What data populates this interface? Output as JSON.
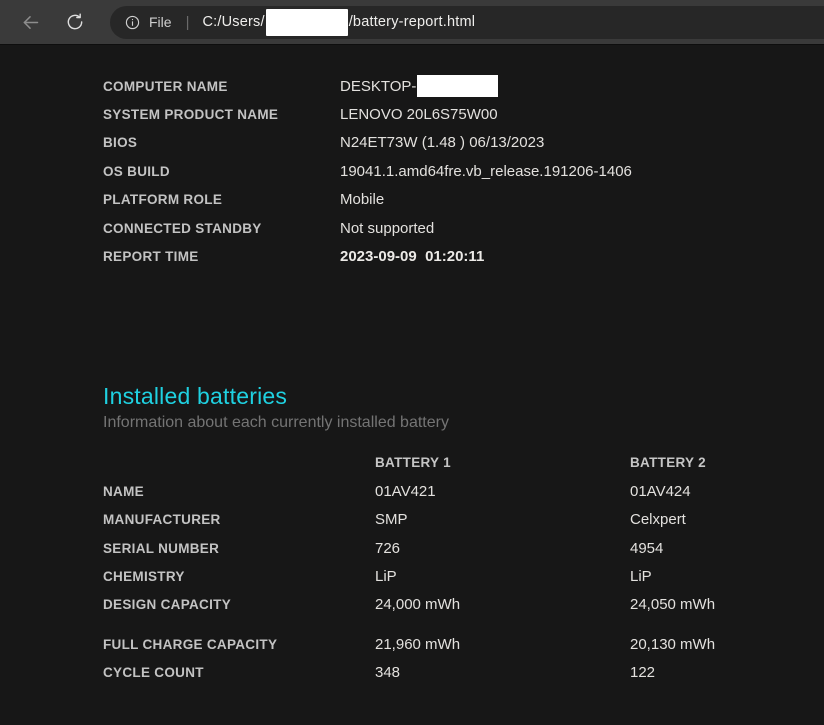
{
  "browser": {
    "address_bar": {
      "file_label": "File",
      "separator": "|",
      "url_prefix": "C:/Users/",
      "url_suffix": "/battery-report.html"
    }
  },
  "system_info": {
    "rows": [
      {
        "label": "COMPUTER NAME",
        "value": "DESKTOP-"
      },
      {
        "label": "SYSTEM PRODUCT NAME",
        "value": "LENOVO 20L6S75W00"
      },
      {
        "label": "BIOS",
        "value": "N24ET73W (1.48 ) 06/13/2023"
      },
      {
        "label": "OS BUILD",
        "value": "19041.1.amd64fre.vb_release.191206-1406"
      },
      {
        "label": "PLATFORM ROLE",
        "value": "Mobile"
      },
      {
        "label": "CONNECTED STANDBY",
        "value": "Not supported"
      },
      {
        "label": "REPORT TIME",
        "value": "2023-09-09  01:20:11"
      }
    ]
  },
  "installed_batteries": {
    "title": "Installed batteries",
    "subtitle": "Information about each currently installed battery",
    "columns": {
      "battery1": "BATTERY 1",
      "battery2": "BATTERY 2"
    },
    "rows": [
      {
        "label": "NAME",
        "battery1": "01AV421",
        "battery2": "01AV424"
      },
      {
        "label": "MANUFACTURER",
        "battery1": "SMP",
        "battery2": "Celxpert"
      },
      {
        "label": "SERIAL NUMBER",
        "battery1": "726",
        "battery2": "4954"
      },
      {
        "label": "CHEMISTRY",
        "battery1": "LiP",
        "battery2": "LiP"
      },
      {
        "label": "DESIGN CAPACITY",
        "battery1": "24,000 mWh",
        "battery2": "24,050 mWh"
      },
      {
        "label": "FULL CHARGE CAPACITY",
        "battery1": "21,960 mWh",
        "battery2": "20,130 mWh"
      },
      {
        "label": "CYCLE COUNT",
        "battery1": "348",
        "battery2": "122"
      }
    ]
  },
  "colors": {
    "heading_accent": "#1fd1e1",
    "page_bg": "#171717",
    "toolbar_bg": "#3a3a3a",
    "address_pill_bg": "#272727",
    "redaction": "#ffffff"
  }
}
